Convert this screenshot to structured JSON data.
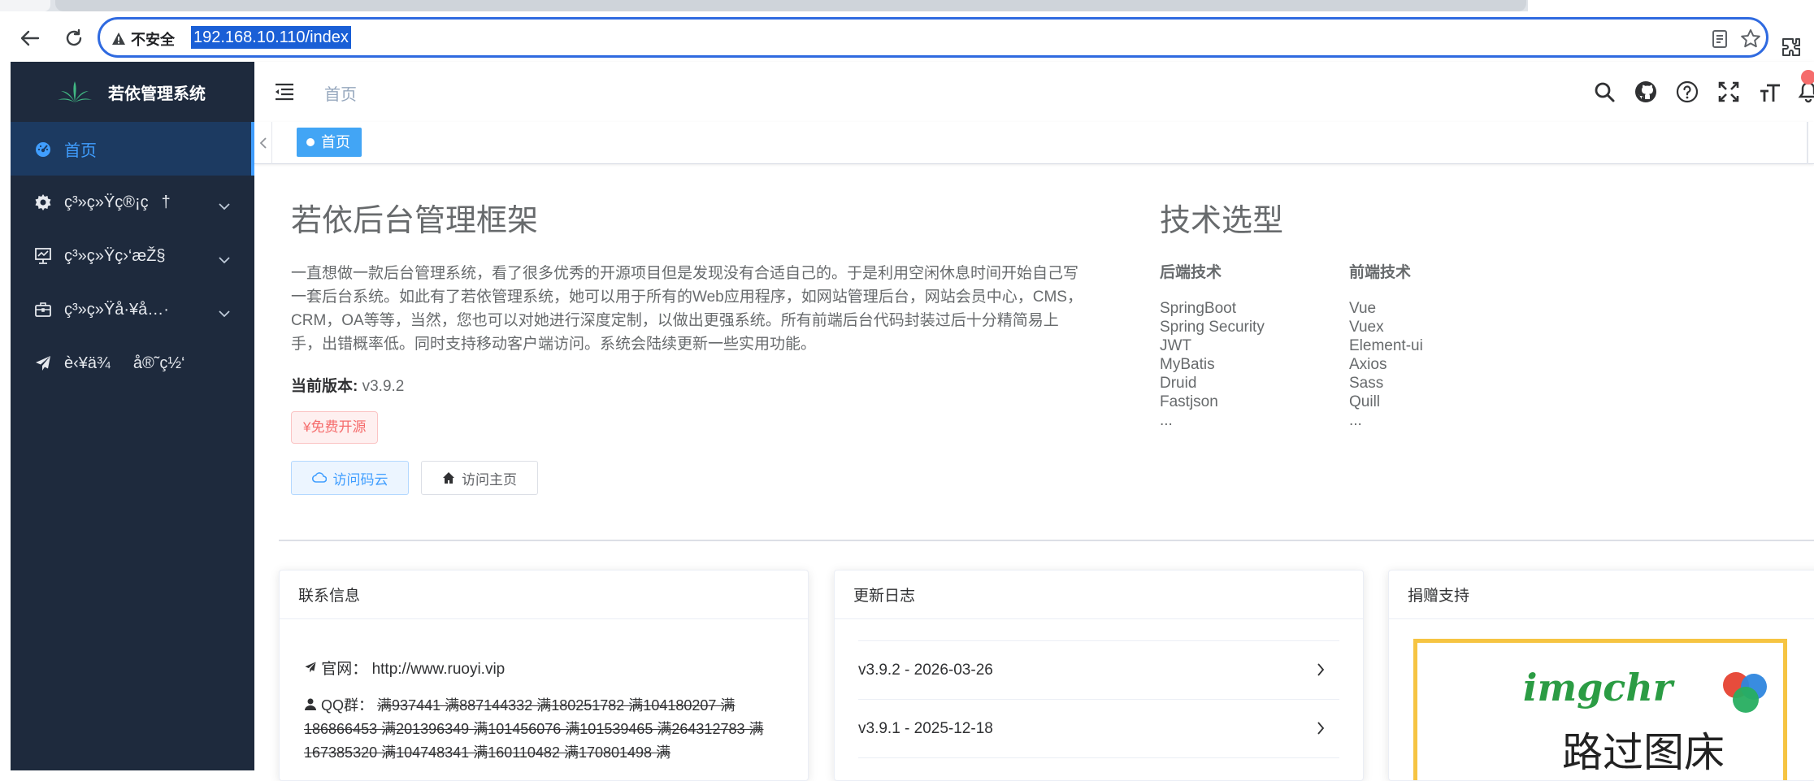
{
  "browser": {
    "security_label": "不安全",
    "url": "192.168.10.110/index"
  },
  "sidebar": {
    "title": "若依管理系统",
    "items": [
      {
        "label": "首页",
        "icon": "dashboard-icon",
        "active": true
      },
      {
        "label": "ç³»ç»Ÿç®¡ç†",
        "icon": "gear-icon"
      },
      {
        "label": "ç³»ç»Ÿç›‘æŽ§",
        "icon": "monitor-icon"
      },
      {
        "label": "ç³»ç»Ÿå·¥å…·",
        "icon": "toolbox-icon"
      },
      {
        "label": "è‹¥ä¾å®˜ç½‘",
        "icon": "send-icon"
      }
    ]
  },
  "navbar": {
    "breadcrumb": "首页"
  },
  "tags": {
    "active_tag": "首页"
  },
  "intro": {
    "title": "若依后台管理框架",
    "paragraph": "一直想做一款后台管理系统，看了很多优秀的开源项目但是发现没有合适自己的。于是利用空闲休息时间开始自己写一套后台系统。如此有了若依管理系统，她可以用于所有的Web应用程序，如网站管理后台，网站会员中心，CMS，CRM，OA等等，当然，您也可以对她进行深度定制，以做出更强系统。所有前端后台代码封装过后十分精简易上手，出错概率低。同时支持移动客户端访问。系统会陆续更新一些实用功能。",
    "version_label": "当前版本:",
    "version_value": "v3.9.2",
    "free_tag": "¥免费开源",
    "btn_gitee": "访问码云",
    "btn_home": "访问主页"
  },
  "tech": {
    "title": "技术选型",
    "backend_title": "后端技术",
    "frontend_title": "前端技术",
    "backend": [
      "SpringBoot",
      "Spring Security",
      "JWT",
      "MyBatis",
      "Druid",
      "Fastjson",
      "..."
    ],
    "frontend": [
      "Vue",
      "Vuex",
      "Element-ui",
      "Axios",
      "Sass",
      "Quill",
      "..."
    ]
  },
  "cards": {
    "contact": {
      "title": "联系信息",
      "website_label": "官网：",
      "website": "http://www.ruoyi.vip",
      "qq_label": "QQ群：",
      "qq_numbers": "满937441 满887144332 满180251782 满104180207 满186866453 满201396349 满101456076 满101539465 满264312783 满167385320 满104748341 满160110482 满170801498 满"
    },
    "changelog": {
      "title": "更新日志",
      "entries": [
        "v3.9.2 - 2026-03-26",
        "v3.9.1 - 2025-12-18"
      ]
    },
    "donate": {
      "title": "捐赠支持",
      "logo_text": "imgchr",
      "sub_text": "路过图床"
    }
  },
  "colors": {
    "sidebar_bg": "#1e2a3d",
    "accent": "#409eff",
    "danger": "#f56c6c"
  }
}
